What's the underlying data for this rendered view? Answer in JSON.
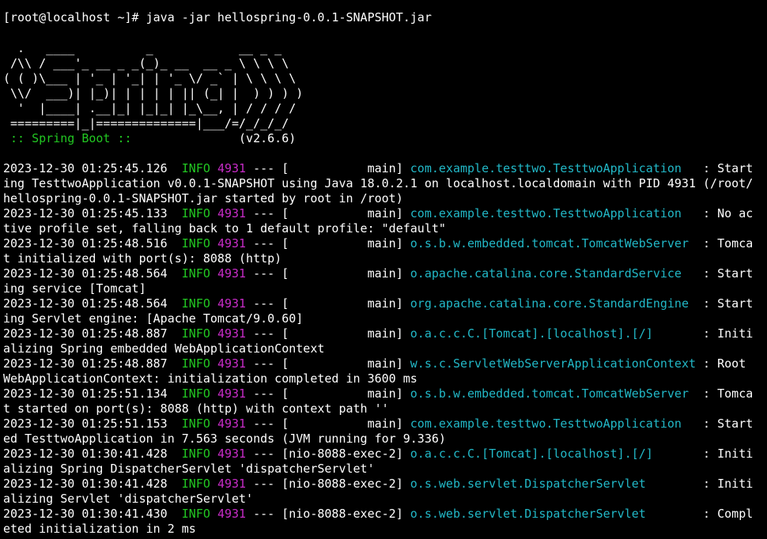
{
  "colors": {
    "background": "#000000",
    "text": "#ffffff",
    "level": "#22c722",
    "pid": "#c72cc7",
    "logger": "#22b8c7"
  },
  "prompt": "[root@localhost ~]# java -jar hellospring-0.0.1-SNAPSHOT.jar",
  "banner": [
    "  .   ____          _            __ _ _",
    " /\\\\ / ___'_ __ _ _(_)_ __  __ _ \\ \\ \\ \\",
    "( ( )\\___ | '_ | '_| | '_ \\/ _` | \\ \\ \\ \\",
    " \\\\/  ___)| |_)| | | | | || (_| |  ) ) ) )",
    "  '  |____| .__|_| |_|_| |_\\__, | / / / /",
    " =========|_|==============|___/=/_/_/_/"
  ],
  "spring_boot": {
    "label": " :: Spring Boot :: ",
    "version": "              (v2.6.6)"
  },
  "logs": [
    {
      "ts": "2023-12-30 01:25:45.126",
      "level": "INFO",
      "pid": "4931",
      "sep": " --- [",
      "thread": "           main] ",
      "logger": "com.example.testtwo.TesttwoApplication  ",
      "msg": " : Start",
      "cont": [
        "ing TesttwoApplication v0.0.1-SNAPSHOT using Java 18.0.2.1 on localhost.localdomain with PID 4931 (/root/",
        "hellospring-0.0.1-SNAPSHOT.jar started by root in /root)"
      ]
    },
    {
      "ts": "2023-12-30 01:25:45.133",
      "level": "INFO",
      "pid": "4931",
      "sep": " --- [",
      "thread": "           main] ",
      "logger": "com.example.testtwo.TesttwoApplication  ",
      "msg": " : No ac",
      "cont": [
        "tive profile set, falling back to 1 default profile: \"default\""
      ]
    },
    {
      "ts": "2023-12-30 01:25:48.516",
      "level": "INFO",
      "pid": "4931",
      "sep": " --- [",
      "thread": "           main] ",
      "logger": "o.s.b.w.embedded.tomcat.TomcatWebServer ",
      "msg": " : Tomca",
      "cont": [
        "t initialized with port(s): 8088 (http)"
      ]
    },
    {
      "ts": "2023-12-30 01:25:48.564",
      "level": "INFO",
      "pid": "4931",
      "sep": " --- [",
      "thread": "           main] ",
      "logger": "o.apache.catalina.core.StandardService  ",
      "msg": " : Start",
      "cont": [
        "ing service [Tomcat]"
      ]
    },
    {
      "ts": "2023-12-30 01:25:48.564",
      "level": "INFO",
      "pid": "4931",
      "sep": " --- [",
      "thread": "           main] ",
      "logger": "org.apache.catalina.core.StandardEngine ",
      "msg": " : Start",
      "cont": [
        "ing Servlet engine: [Apache Tomcat/9.0.60]"
      ]
    },
    {
      "ts": "2023-12-30 01:25:48.887",
      "level": "INFO",
      "pid": "4931",
      "sep": " --- [",
      "thread": "           main] ",
      "logger": "o.a.c.c.C.[Tomcat].[localhost].[/]      ",
      "msg": " : Initi",
      "cont": [
        "alizing Spring embedded WebApplicationContext"
      ]
    },
    {
      "ts": "2023-12-30 01:25:48.887",
      "level": "INFO",
      "pid": "4931",
      "sep": " --- [",
      "thread": "           main] ",
      "logger": "w.s.c.ServletWebServerApplicationContext",
      "msg": " : Root",
      "cont": [
        "WebApplicationContext: initialization completed in 3600 ms"
      ]
    },
    {
      "ts": "2023-12-30 01:25:51.134",
      "level": "INFO",
      "pid": "4931",
      "sep": " --- [",
      "thread": "           main] ",
      "logger": "o.s.b.w.embedded.tomcat.TomcatWebServer ",
      "msg": " : Tomca",
      "cont": [
        "t started on port(s): 8088 (http) with context path ''"
      ]
    },
    {
      "ts": "2023-12-30 01:25:51.153",
      "level": "INFO",
      "pid": "4931",
      "sep": " --- [",
      "thread": "           main] ",
      "logger": "com.example.testtwo.TesttwoApplication  ",
      "msg": " : Start",
      "cont": [
        "ed TesttwoApplication in 7.563 seconds (JVM running for 9.336)"
      ]
    },
    {
      "ts": "2023-12-30 01:30:41.428",
      "level": "INFO",
      "pid": "4931",
      "sep": " --- [",
      "thread": "nio-8088-exec-2] ",
      "logger": "o.a.c.c.C.[Tomcat].[localhost].[/]      ",
      "msg": " : Initi",
      "cont": [
        "alizing Spring DispatcherServlet 'dispatcherServlet'"
      ]
    },
    {
      "ts": "2023-12-30 01:30:41.428",
      "level": "INFO",
      "pid": "4931",
      "sep": " --- [",
      "thread": "nio-8088-exec-2] ",
      "logger": "o.s.web.servlet.DispatcherServlet       ",
      "msg": " : Initi",
      "cont": [
        "alizing Servlet 'dispatcherServlet'"
      ]
    },
    {
      "ts": "2023-12-30 01:30:41.430",
      "level": "INFO",
      "pid": "4931",
      "sep": " --- [",
      "thread": "nio-8088-exec-2] ",
      "logger": "o.s.web.servlet.DispatcherServlet       ",
      "msg": " : Compl",
      "cont": [
        "eted initialization in 2 ms"
      ]
    }
  ]
}
